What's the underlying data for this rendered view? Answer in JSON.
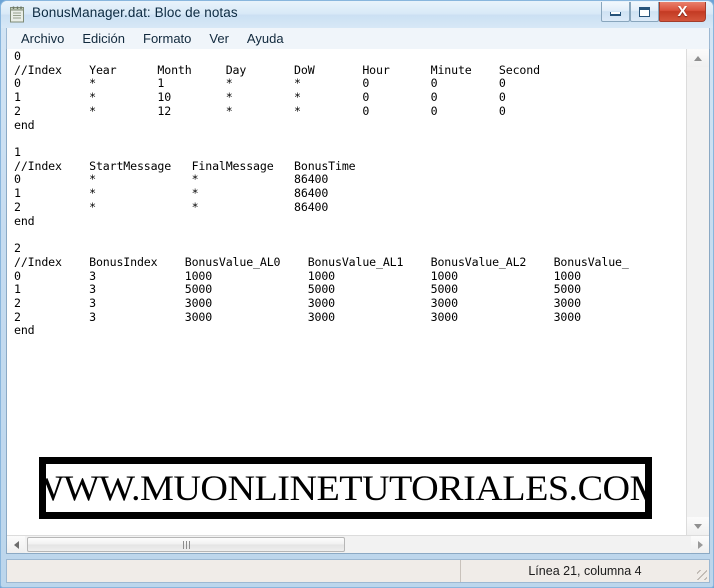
{
  "window": {
    "title": "BonusManager.dat: Bloc de notas",
    "icon": "notepad-icon",
    "buttons": {
      "minimize": "minimize-icon",
      "maximize": "maximize-icon",
      "close": "X"
    }
  },
  "menubar": {
    "items": [
      {
        "label": "Archivo"
      },
      {
        "label": "Edición"
      },
      {
        "label": "Formato"
      },
      {
        "label": "Ver"
      },
      {
        "label": "Ayuda"
      }
    ]
  },
  "editor": {
    "content": "0\n//Index    Year      Month     Day       DoW       Hour      Minute    Second\n0          *         1         *         *         0         0         0\n1          *         10        *         *         0         0         0\n2          *         12        *         *         0         0         0\nend\n\n1\n//Index    StartMessage   FinalMessage   BonusTime\n0          *              *              86400\n1          *              *              86400\n2          *              *              86400\nend\n\n2\n//Index    BonusIndex    BonusValue_AL0    BonusValue_AL1    BonusValue_AL2    BonusValue_\n0          3             1000              1000              1000              1000\n1          3             5000              5000              5000              5000\n2          3             3000              3000              3000              3000\n2          3             3000              3000              3000              3000\nend"
  },
  "scrollbars": {
    "vertical": {
      "up": "scroll-up-arrow",
      "down": "scroll-down-arrow"
    },
    "horizontal": {
      "left": "scroll-left-arrow",
      "right": "scroll-right-arrow",
      "grip": "scroll-thumb-grip"
    }
  },
  "statusbar": {
    "position_text": "Línea 21, columna 4"
  },
  "watermark": {
    "text": "WWW.MUONLINETUTORIALES.COM"
  },
  "colors": {
    "window_frame": "#bcd6ec",
    "titlebar": "#d8e9f7",
    "close_button": "#c33a23",
    "editor_background": "#ffffff",
    "statusbar": "#f0ece8",
    "text": "#000000"
  }
}
